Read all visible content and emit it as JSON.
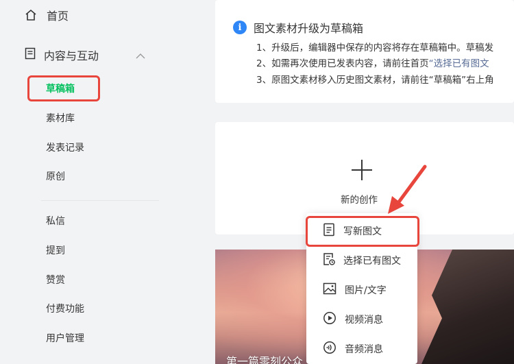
{
  "sidebar": {
    "home": {
      "label": "首页",
      "icon": "home-icon"
    },
    "section": {
      "label": "内容与互动",
      "icon": "document-icon",
      "expanded": true
    },
    "sub_items": [
      {
        "label": "草稿箱",
        "active": true
      },
      {
        "label": "素材库"
      },
      {
        "label": "发表记录"
      },
      {
        "label": "原创"
      }
    ],
    "more_items": [
      {
        "label": "私信"
      },
      {
        "label": "提到"
      },
      {
        "label": "赞赏"
      },
      {
        "label": "付费功能"
      },
      {
        "label": "用户管理"
      }
    ]
  },
  "notice": {
    "title": "图文素材升级为草稿箱",
    "line1": "1、升级后，编辑器中保存的内容将存在草稿箱中。草稿发",
    "line2_prefix": "2、如需再次使用已发表内容，请前往首页",
    "line2_link": "“选择已有图文",
    "line3": "3、原图文素材移入历史图文素材，请前往“草稿箱”右上角"
  },
  "create": {
    "label": "新的创作"
  },
  "dropdown": {
    "items": [
      {
        "label": "写新图文",
        "icon": "new-article-icon"
      },
      {
        "label": "选择已有图文",
        "icon": "existing-article-icon"
      },
      {
        "label": "图片/文字",
        "icon": "image-icon"
      },
      {
        "label": "视频消息",
        "icon": "video-play-icon"
      },
      {
        "label": "音频消息",
        "icon": "audio-icon"
      }
    ]
  },
  "draft_thumb": {
    "caption": "第一篇零刻公众"
  },
  "colors": {
    "accent_green": "#07c160",
    "highlight_red": "#e8453c",
    "info_blue": "#2f86f6",
    "link": "#576b95"
  }
}
